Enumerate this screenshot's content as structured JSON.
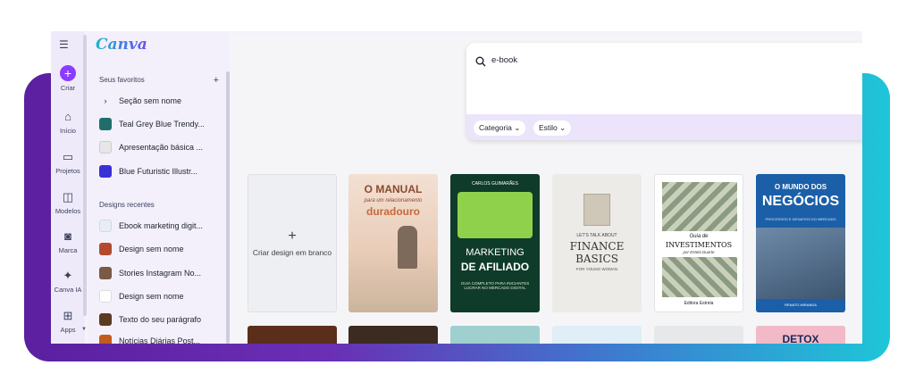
{
  "app": {
    "logo": "Canva"
  },
  "rail": {
    "items": [
      {
        "label": "Criar",
        "icon": "plus-icon"
      },
      {
        "label": "Início",
        "icon": "home-icon"
      },
      {
        "label": "Projetos",
        "icon": "folder-icon"
      },
      {
        "label": "Modelos",
        "icon": "templates-icon"
      },
      {
        "label": "Marca",
        "icon": "brand-icon"
      },
      {
        "label": "Canva IA",
        "icon": "sparkle-icon"
      },
      {
        "label": "Apps",
        "icon": "apps-icon"
      }
    ]
  },
  "panel": {
    "favorites_title": "Seus favoritos",
    "favorites": [
      {
        "label": "Seção sem nome"
      },
      {
        "label": "Teal Grey Blue Trendy..."
      },
      {
        "label": "Apresentação básica ..."
      },
      {
        "label": "Blue Futuristic Illustr..."
      }
    ],
    "recent_title": "Designs recentes",
    "recent": [
      {
        "label": "Ebook marketing digit..."
      },
      {
        "label": "Design sem nome"
      },
      {
        "label": "Stories Instagram No..."
      },
      {
        "label": "Design sem nome"
      },
      {
        "label": "Texto do seu parágrafo"
      },
      {
        "label": "Notícias Diárias Post..."
      }
    ]
  },
  "search": {
    "value": "e-book",
    "filters": [
      {
        "label": "Categoria"
      },
      {
        "label": "Estilo"
      }
    ]
  },
  "results": {
    "blank_label": "Criar design em branco",
    "cards": [
      {
        "line1": "O MANUAL",
        "line2": "para um relacionamento",
        "line3": "duradouro"
      },
      {
        "line1": "CARLOS GUIMARÃES",
        "line2": "MARKETING",
        "line3": "DE AFILIADO",
        "line4": "GUIA COMPLETO PARA INICIANTES LUCRAR NO MERCADO DIGITAL"
      },
      {
        "line1": "LET'S TALK ABOUT",
        "line2": "FINANCE",
        "line3": "BASICS",
        "line4": "FOR YOUNG WOMAN"
      },
      {
        "line1": "Guia de",
        "line2": "INVESTIMENTOS",
        "line3": "por Estela Duarte",
        "line4": "Editora Estrela"
      },
      {
        "line1": "O MUNDO DOS",
        "line2": "NEGÓCIOS",
        "line3": "PROCESSOS E DESAFIOS DO MERCADO",
        "line4": "RENATO MIRANDA"
      }
    ],
    "row2_text": "DETOX"
  }
}
